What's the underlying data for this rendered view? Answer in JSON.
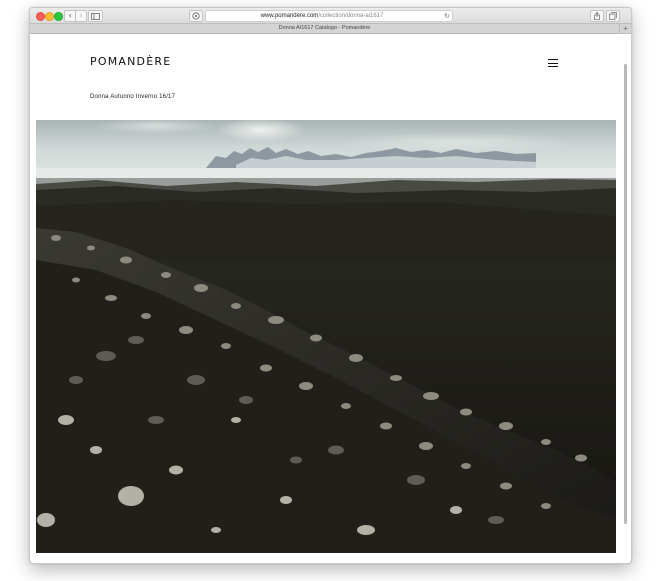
{
  "browser": {
    "url_domain": "www.pomandere.com",
    "url_path": "/collection/donna-ai1617",
    "tab_title": "Donna AI1617 Catalogo - Pomandère",
    "icons": {
      "back": "chevron-left-icon",
      "forward": "chevron-right-icon",
      "sidebar": "sidebar-icon",
      "reader": "reader-icon",
      "reload": "reload-icon",
      "share": "share-icon",
      "tabs": "tabs-overview-icon",
      "new_tab": "plus-icon"
    }
  },
  "site": {
    "logo": "POMANDÈRE",
    "subtitle": "Donna Autunno Inverno 16/17",
    "menu_icon": "hamburger-menu-icon"
  },
  "hero": {
    "description": "landscape-photo"
  },
  "colors": {
    "red": "#fc5f57",
    "yellow": "#fdbc2e",
    "green": "#29c840"
  }
}
